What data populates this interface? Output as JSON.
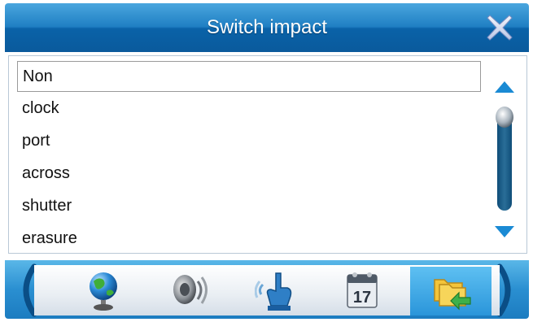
{
  "window": {
    "title": "Switch impact",
    "close_icon": "close-x-icon"
  },
  "list": {
    "selected_index": 0,
    "items": [
      {
        "label": "Non"
      },
      {
        "label": "clock"
      },
      {
        "label": "port"
      },
      {
        "label": "across"
      },
      {
        "label": "shutter"
      },
      {
        "label": "erasure"
      }
    ],
    "scroll_position": 0.1
  },
  "toolbar": {
    "active_index": 4,
    "tools": [
      {
        "icon": "globe-icon"
      },
      {
        "icon": "speaker-icon"
      },
      {
        "icon": "touch-hand-icon"
      },
      {
        "icon": "calendar-icon",
        "calendar_day": "17"
      },
      {
        "icon": "folder-arrow-icon"
      }
    ]
  },
  "colors": {
    "titlebar": "#1f7fc3",
    "toolbar_active": "#2a95da",
    "scroll_arrow": "#1a8ad4",
    "scroll_track": "#0e4d78"
  }
}
